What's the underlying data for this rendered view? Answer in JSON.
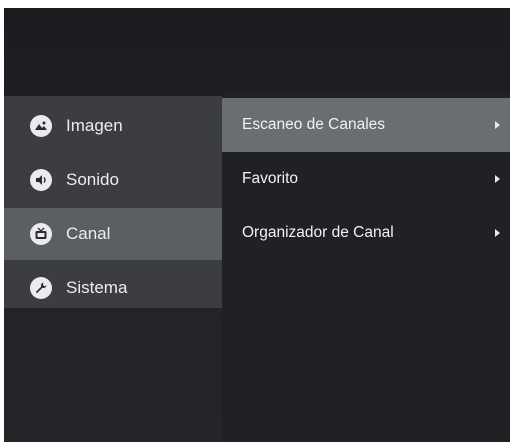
{
  "menu": {
    "items": [
      {
        "label": "Imagen",
        "icon": "image-icon"
      },
      {
        "label": "Sonido",
        "icon": "sound-icon"
      },
      {
        "label": "Canal",
        "icon": "tv-icon",
        "selected": true
      },
      {
        "label": "Sistema",
        "icon": "wrench-icon"
      }
    ]
  },
  "submenu": {
    "items": [
      {
        "label": "Escaneo de Canales",
        "highlighted": true
      },
      {
        "label": "Favorito"
      },
      {
        "label": "Organizador de Canal"
      }
    ]
  },
  "colors": {
    "background": "#1f2125",
    "left_panel": "#3b3d41",
    "selected_item": "#5b5e62",
    "highlight_item": "#6a6d72",
    "text": "#eceef0"
  }
}
